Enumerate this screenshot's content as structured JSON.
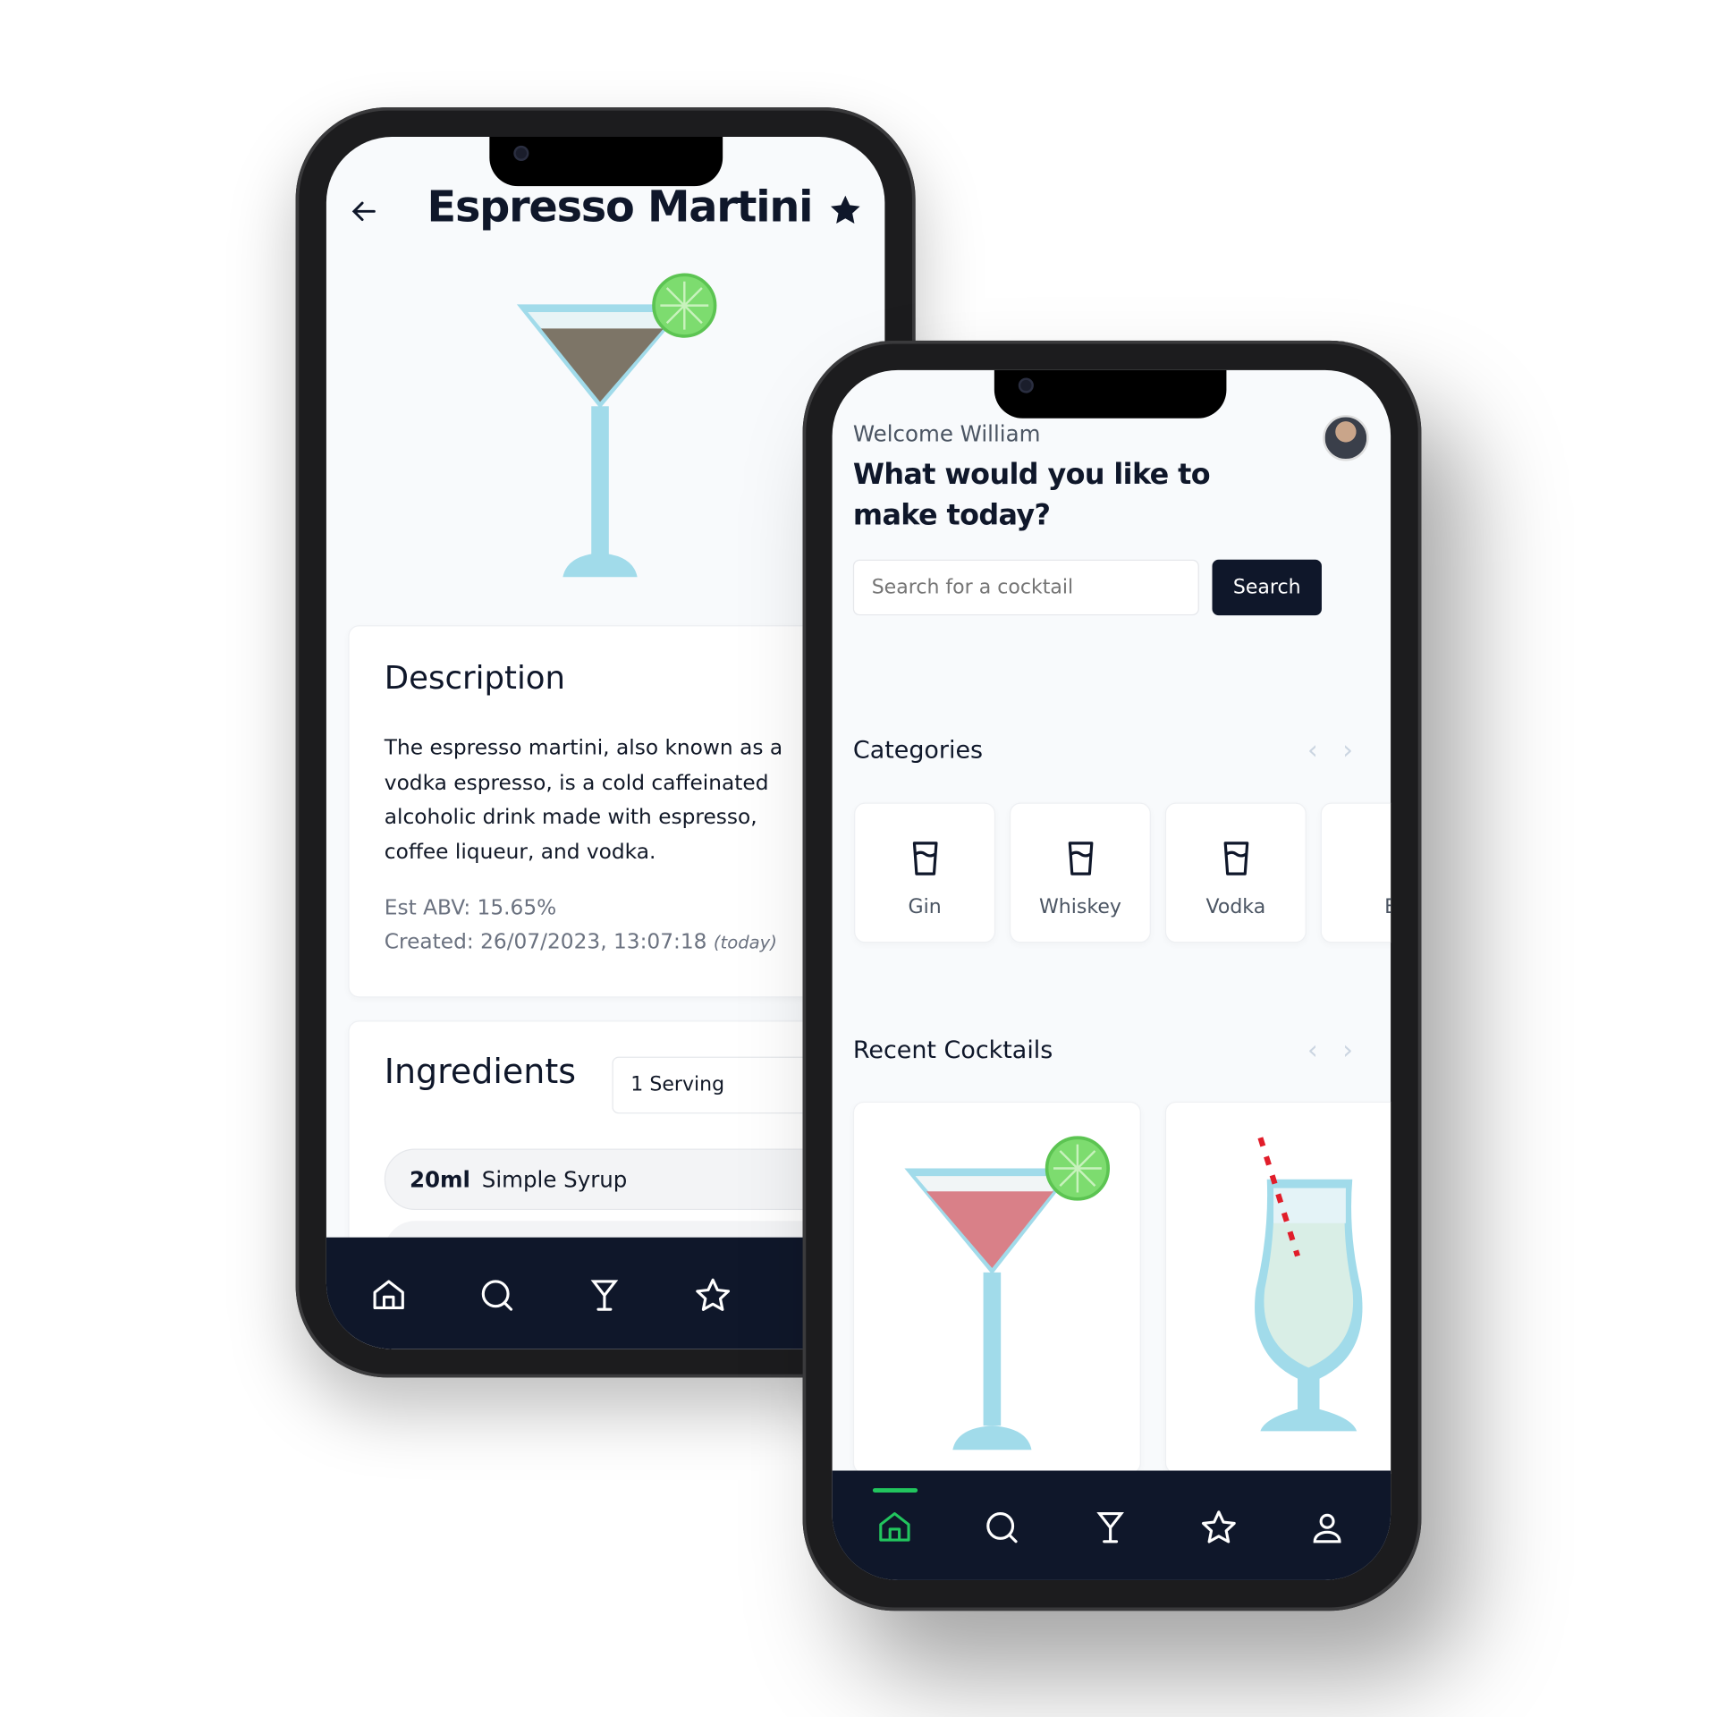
{
  "detail_screen": {
    "title": "Espresso Martini",
    "description_heading": "Description",
    "description": "The espresso martini, also known as a vodka espresso, is a cold caffeinated alcoholic drink made with espresso, coffee liqueur, and vodka.",
    "abv": "Est ABV: 15.65%",
    "created": "Created: 26/07/2023, 13:07:18",
    "created_relative": "(today)",
    "ingredients_heading": "Ingredients",
    "serving_select": "1 Serving",
    "ingredients": [
      {
        "amount": "20ml",
        "name": "Simple Syrup"
      }
    ],
    "nav_icons": [
      "home-icon",
      "search-icon",
      "cocktail-icon",
      "star-icon"
    ]
  },
  "home_screen": {
    "welcome": "Welcome William",
    "heading": "What would you like to make today?",
    "search_placeholder": "Search for a cocktail",
    "search_button": "Search",
    "categories_heading": "Categories",
    "categories": [
      {
        "label": "Gin"
      },
      {
        "label": "Whiskey"
      },
      {
        "label": "Vodka"
      },
      {
        "label": "B"
      }
    ],
    "recent_heading": "Recent Cocktails",
    "nav_icons": [
      "home-icon",
      "search-icon",
      "cocktail-icon",
      "star-icon",
      "user-icon"
    ],
    "active_nav": "home-icon"
  },
  "colors": {
    "nav_bg": "#0f172a",
    "accent": "#22c55e",
    "glass": "#a1dbea",
    "lime": "#7ddc6f",
    "espresso": "#7d7567",
    "cosmo": "#d98088"
  }
}
